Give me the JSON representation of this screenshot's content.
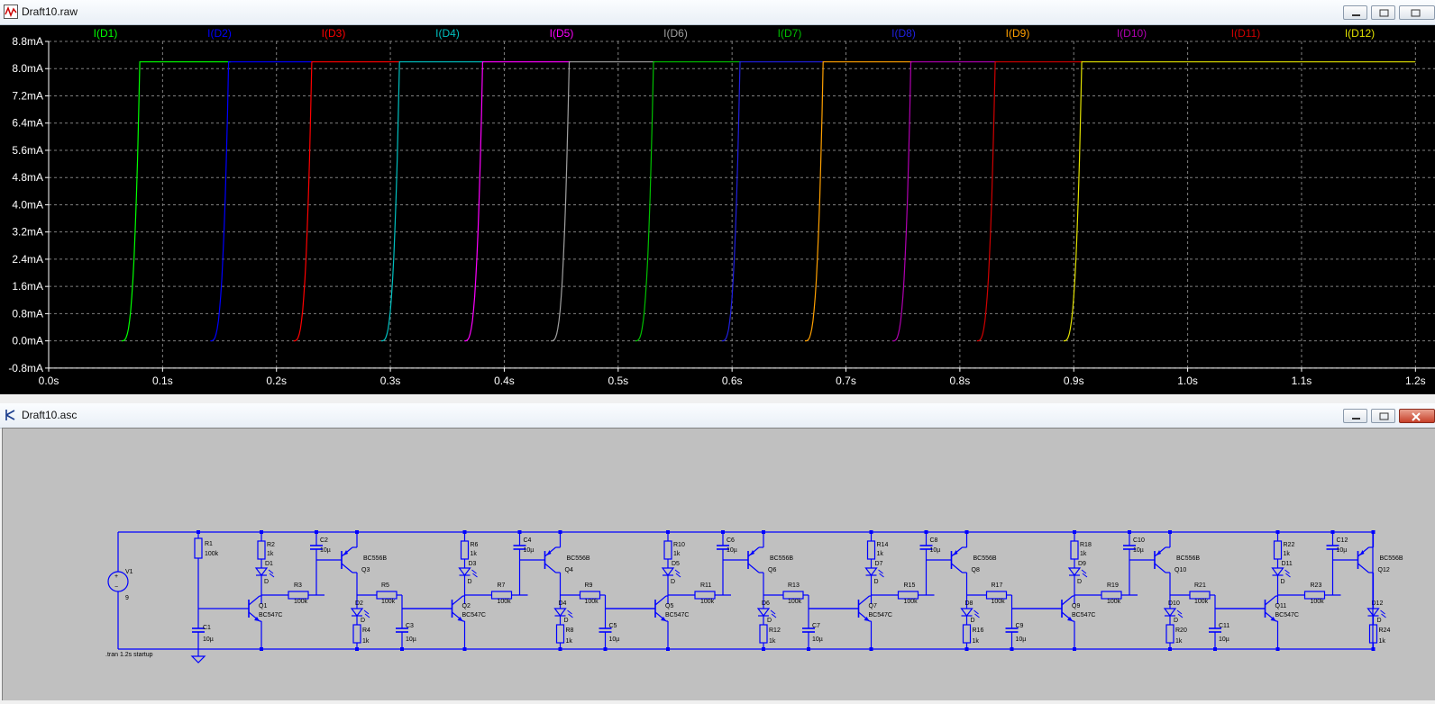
{
  "waveform_window": {
    "title": "Draft10.raw"
  },
  "schematic_window": {
    "title": "Draft10.asc"
  },
  "chart_data": {
    "type": "line",
    "xlabel": "",
    "ylabel": "",
    "xlim": [
      0.0,
      1.2
    ],
    "ylim": [
      -0.8,
      8.8
    ],
    "x_ticks": [
      "0.0s",
      "0.1s",
      "0.2s",
      "0.3s",
      "0.4s",
      "0.5s",
      "0.6s",
      "0.7s",
      "0.8s",
      "0.9s",
      "1.0s",
      "1.1s",
      "1.2s"
    ],
    "y_ticks": [
      "-0.8mA",
      "0.0mA",
      "0.8mA",
      "1.6mA",
      "2.4mA",
      "3.2mA",
      "4.0mA",
      "4.8mA",
      "5.6mA",
      "6.4mA",
      "7.2mA",
      "8.0mA",
      "8.8mA"
    ],
    "grid": true,
    "legend_position": "top",
    "series": [
      {
        "name": "I(D1)",
        "color": "#00ff00",
        "rise_s": 0.08,
        "off_s": 0.16,
        "high_mA": 8.2
      },
      {
        "name": "I(D2)",
        "color": "#0000ff",
        "rise_s": 0.158,
        "off_s": 0.232,
        "high_mA": 8.2
      },
      {
        "name": "I(D3)",
        "color": "#ff0000",
        "rise_s": 0.231,
        "off_s": 0.308,
        "high_mA": 8.2
      },
      {
        "name": "I(D4)",
        "color": "#00c0c0",
        "rise_s": 0.308,
        "off_s": 0.382,
        "high_mA": 8.2
      },
      {
        "name": "I(D5)",
        "color": "#ff00ff",
        "rise_s": 0.381,
        "off_s": 0.458,
        "high_mA": 8.2
      },
      {
        "name": "I(D6)",
        "color": "#a0a0a0",
        "rise_s": 0.457,
        "off_s": 0.532,
        "high_mA": 8.2
      },
      {
        "name": "I(D7)",
        "color": "#00c000",
        "rise_s": 0.531,
        "off_s": 0.608,
        "high_mA": 8.2
      },
      {
        "name": "I(D8)",
        "color": "#2020e0",
        "rise_s": 0.607,
        "off_s": 0.681,
        "high_mA": 8.2
      },
      {
        "name": "I(D9)",
        "color": "#ffa000",
        "rise_s": 0.68,
        "off_s": 0.758,
        "high_mA": 8.2
      },
      {
        "name": "I(D10)",
        "color": "#b000b0",
        "rise_s": 0.757,
        "off_s": 0.832,
        "high_mA": 8.2
      },
      {
        "name": "I(D11)",
        "color": "#d00000",
        "rise_s": 0.831,
        "off_s": 0.908,
        "high_mA": 8.2
      },
      {
        "name": "I(D12)",
        "color": "#e0e000",
        "rise_s": 0.907,
        "off_s": 1.2,
        "high_mA": 8.2
      }
    ]
  },
  "schematic": {
    "stages": [
      {
        "ra": "R1",
        "ra_val": "100k",
        "rl": "R2",
        "rl_val": "1k",
        "dled": "D1",
        "cfb": "C2",
        "cfb_val": "10µ",
        "pnp": "Q3",
        "pnp_model": "BC556B",
        "rb": "R3",
        "rb_val": "100k",
        "npn": "Q1",
        "npn_model": "BC547C",
        "d2": "D2",
        "rc": "R4",
        "rc_val": "1k",
        "rn": "R5",
        "rn_val": "100k",
        "ct": "C1",
        "ct_val": "10µ"
      },
      {
        "ra": "",
        "ra_val": "",
        "rl": "R6",
        "rl_val": "1k",
        "dled": "D3",
        "cfb": "C4",
        "cfb_val": "10µ",
        "pnp": "Q4",
        "pnp_model": "BC556B",
        "rb": "R7",
        "rb_val": "100k",
        "npn": "Q2",
        "npn_model": "BC547C",
        "d2": "D4",
        "rc": "R8",
        "rc_val": "1k",
        "rn": "R9",
        "rn_val": "100k",
        "ct": "C3",
        "ct_val": "10µ"
      },
      {
        "ra": "",
        "ra_val": "",
        "rl": "R10",
        "rl_val": "1k",
        "dled": "D5",
        "cfb": "C6",
        "cfb_val": "10µ",
        "pnp": "Q6",
        "pnp_model": "BC556B",
        "rb": "R11",
        "rb_val": "100k",
        "npn": "Q5",
        "npn_model": "BC547C",
        "d2": "D6",
        "rc": "R12",
        "rc_val": "1k",
        "rn": "R13",
        "rn_val": "100k",
        "ct": "C5",
        "ct_val": "10µ"
      },
      {
        "ra": "",
        "ra_val": "",
        "rl": "R14",
        "rl_val": "1k",
        "dled": "D7",
        "cfb": "C8",
        "cfb_val": "10µ",
        "pnp": "Q8",
        "pnp_model": "BC556B",
        "rb": "R15",
        "rb_val": "100k",
        "npn": "Q7",
        "npn_model": "BC547C",
        "d2": "D8",
        "rc": "R16",
        "rc_val": "1k",
        "rn": "R17",
        "rn_val": "100k",
        "ct": "C7",
        "ct_val": "10µ"
      },
      {
        "ra": "",
        "ra_val": "",
        "rl": "R18",
        "rl_val": "1k",
        "dled": "D9",
        "cfb": "C10",
        "cfb_val": "10µ",
        "pnp": "Q10",
        "pnp_model": "BC556B",
        "rb": "R19",
        "rb_val": "100k",
        "npn": "Q9",
        "npn_model": "BC547C",
        "d2": "D10",
        "rc": "R20",
        "rc_val": "1k",
        "rn": "R21",
        "rn_val": "100k",
        "ct": "C9",
        "ct_val": "10µ"
      },
      {
        "ra": "",
        "ra_val": "",
        "rl": "R22",
        "rl_val": "1k",
        "dled": "D11",
        "cfb": "C12",
        "cfb_val": "10µ",
        "pnp": "Q12",
        "pnp_model": "BC556B",
        "rb": "R23",
        "rb_val": "100k",
        "npn": "Q11",
        "npn_model": "BC547C",
        "d2": "D12",
        "rc": "R24",
        "rc_val": "1k",
        "rn": "",
        "rn_val": "",
        "ct": "C11",
        "ct_val": "10µ"
      }
    ],
    "source": {
      "name": "V1",
      "value": "9"
    },
    "directive": ".tran 1.2s startup"
  },
  "colors": {
    "wire": "#0000ff",
    "schematic_bg": "#c0c0c0",
    "plot_bg": "#000000",
    "grid": "#808080",
    "axis_text": "#ffffff"
  }
}
